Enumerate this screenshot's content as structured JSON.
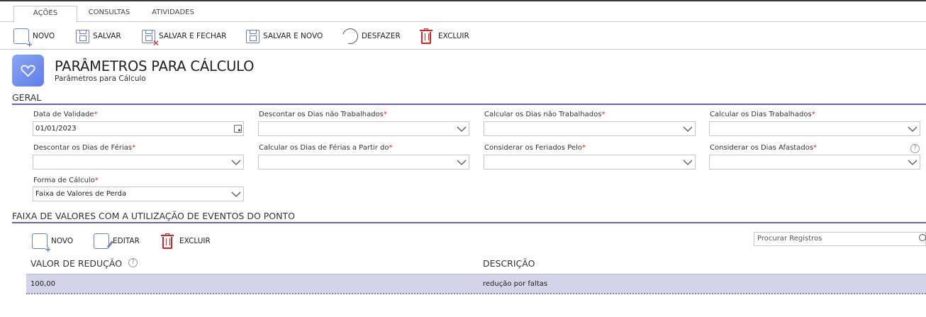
{
  "tabs": [
    "AÇÕES",
    "CONSULTAS",
    "ATIVIDADES"
  ],
  "toolbar": {
    "novo": "NOVO",
    "salvar": "SALVAR",
    "salvar_fechar": "SALVAR E FECHAR",
    "salvar_novo": "SALVAR E NOVO",
    "desfazer": "DESFAZER",
    "excluir": "EXCLUIR"
  },
  "page": {
    "title": "PARÂMETROS PARA CÁLCULO",
    "subtitle": "Parâmetros para Cálculo"
  },
  "geral": {
    "section": "GERAL",
    "required_mark": "*",
    "fields": {
      "data_validade": {
        "label": "Data de Validade",
        "value": "01/01/2023"
      },
      "descontar_nao_trab": {
        "label": "Descontar os Dias não Trabalhados",
        "value": ""
      },
      "calcular_nao_trab": {
        "label": "Calcular os Dias não Trabalhados",
        "value": ""
      },
      "calcular_trab": {
        "label": "Calcular os Dias Trabalhados",
        "value": ""
      },
      "descontar_ferias": {
        "label": "Descontar os Dias de Férias",
        "value": ""
      },
      "calcular_ferias": {
        "label": "Calcular os Dias de Férias a Partir do",
        "value": ""
      },
      "considerar_feriados": {
        "label": "Considerar os Feriados Pelo",
        "value": ""
      },
      "considerar_afastados": {
        "label": "Considerar os Dias Afastados",
        "value": ""
      },
      "forma_calculo": {
        "label": "Forma de Cálculo",
        "value": "Faixa de Valores de Perda"
      }
    }
  },
  "faixa": {
    "section": "FAIXA DE VALORES COM A UTILIZAÇÃO DE EVENTOS DO PONTO",
    "toolbar": {
      "novo": "NOVO",
      "editar": "EDITAR",
      "excluir": "EXCLUIR"
    },
    "search_placeholder": "Procurar Registros",
    "columns": [
      "VALOR DE REDUÇÃO",
      "DESCRIÇÃO"
    ],
    "rows": [
      {
        "valor": "100,00",
        "descricao": "redução por faltas"
      }
    ]
  },
  "colors": {
    "accent": "#6a60c4",
    "danger": "#e02020",
    "row_selected": "#d3d4e8"
  }
}
